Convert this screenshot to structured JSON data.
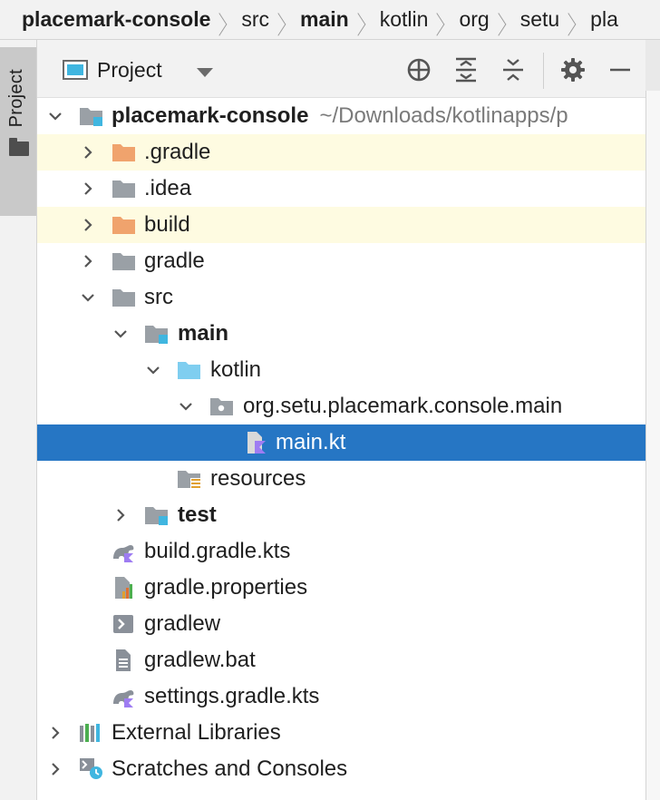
{
  "breadcrumb": {
    "items": [
      {
        "label": "placemark-console",
        "bold": true
      },
      {
        "label": "src",
        "bold": false
      },
      {
        "label": "main",
        "bold": true
      },
      {
        "label": "kotlin",
        "bold": false
      },
      {
        "label": "org",
        "bold": false
      },
      {
        "label": "setu",
        "bold": false
      },
      {
        "label": "pla",
        "bold": false
      }
    ]
  },
  "tool_strip": {
    "tab_label": "Project",
    "tab_icon": "folder-icon"
  },
  "panel": {
    "title": "Project",
    "buttons": [
      "locate-icon",
      "expand-all-icon",
      "collapse-all-icon",
      "gear-icon",
      "minimize-icon"
    ]
  },
  "tree": {
    "root": {
      "name": "placemark-console",
      "path": "~/Downloads/kotlinapps/p"
    },
    "items": {
      "gradle_dir": ".gradle",
      "idea_dir": ".idea",
      "build_dir": "build",
      "gradle_folder": "gradle",
      "src": "src",
      "main": "main",
      "kotlin": "kotlin",
      "package": "org.setu.placemark.console.main",
      "main_kt": "main.kt",
      "resources": "resources",
      "test": "test",
      "build_gradle_kts": "build.gradle.kts",
      "gradle_properties": "gradle.properties",
      "gradlew": "gradlew",
      "gradlew_bat": "gradlew.bat",
      "settings_gradle_kts": "settings.gradle.kts",
      "external_libraries": "External Libraries",
      "scratches": "Scratches and Consoles"
    }
  },
  "colors": {
    "selection": "#2676c4",
    "excluded_folder": "#f0a36d",
    "excluded_row": "#fefbe1",
    "source_root": "#40b6e0",
    "kotlin_purple": "#9e7cf2"
  }
}
